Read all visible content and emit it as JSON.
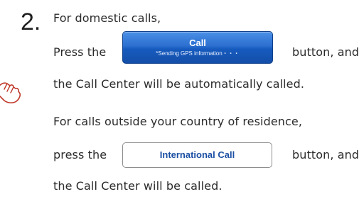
{
  "step": {
    "number": "2.",
    "line1": "For domestic calls,",
    "line2_prefix": "Press the",
    "line2_suffix": "button, and",
    "line3": "the Call Center will be automatically called.",
    "line4": "For calls outside your country of residence,",
    "line5_prefix": "press the",
    "line5_suffix": "button, and",
    "line6": "the Call Center will be called."
  },
  "call_button": {
    "label": "Call",
    "sublabel": "*Sending GPS information・・・",
    "color": "#2c6fd0"
  },
  "intl_button": {
    "label": "International Call",
    "text_color": "#1b4fa3"
  },
  "icons": {
    "pointer": "hand-pointer-icon"
  }
}
